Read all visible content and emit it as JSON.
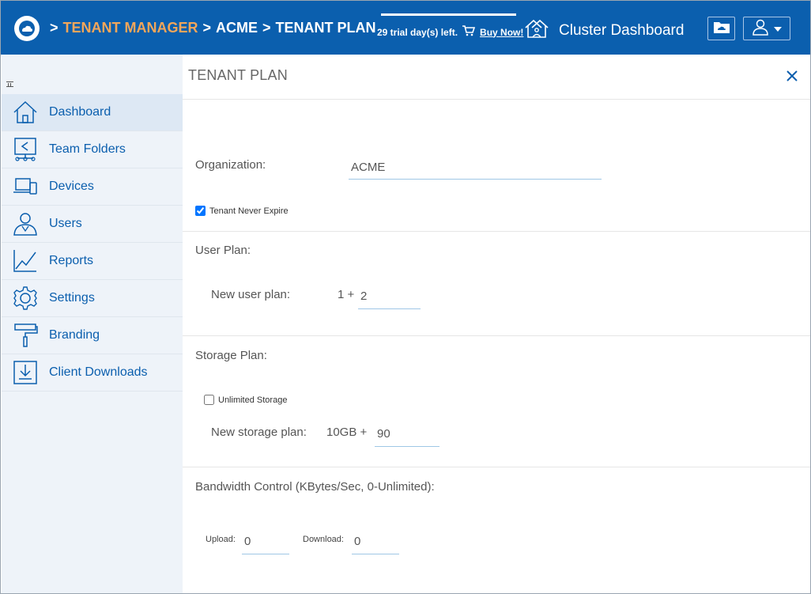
{
  "header": {
    "breadcrumb": {
      "sep": ">",
      "tenant_manager": "TENANT MANAGER",
      "acme": "ACME",
      "tenant_plan": "TENANT PLAN"
    },
    "trial_text": "29 trial day(s) left.",
    "buy_now": "Buy Now!",
    "cluster_dashboard": "Cluster Dashboard",
    "icons": {
      "logo": "cloud-logo-icon",
      "cart": "cart-icon",
      "cluster": "houses-icon",
      "folder": "cloud-folder-icon",
      "user": "user-icon",
      "caret": "caret-down-icon"
    }
  },
  "sidebar": {
    "items": [
      {
        "label": "Dashboard",
        "icon": "home-icon"
      },
      {
        "label": "Team Folders",
        "icon": "team-folder-icon"
      },
      {
        "label": "Devices",
        "icon": "devices-icon"
      },
      {
        "label": "Users",
        "icon": "users-icon"
      },
      {
        "label": "Reports",
        "icon": "reports-icon"
      },
      {
        "label": "Settings",
        "icon": "gear-icon"
      },
      {
        "label": "Branding",
        "icon": "paint-roller-icon"
      },
      {
        "label": "Client Downloads",
        "icon": "download-icon"
      }
    ]
  },
  "panel": {
    "title": "TENANT PLAN",
    "organization_label": "Organization:",
    "organization_value": "ACME",
    "never_expire_label": "Tenant Never Expire",
    "never_expire_checked": true,
    "user_plan_heading": "User Plan:",
    "new_user_plan_label": "New user plan:",
    "user_plan_base": "1 +",
    "user_plan_value": "2",
    "storage_plan_heading": "Storage Plan:",
    "unlimited_storage_label": "Unlimited Storage",
    "unlimited_storage_checked": false,
    "new_storage_plan_label": "New storage plan:",
    "storage_plan_base": "10GB +",
    "storage_plan_value": "90",
    "bandwidth_heading": "Bandwidth Control (KBytes/Sec, 0-Unlimited):",
    "upload_label": "Upload:",
    "upload_value": "0",
    "download_label": "Download:",
    "download_value": "0"
  },
  "colors": {
    "brand": "#0b5fae",
    "accent_orange": "#f2a65a",
    "sidebar_bg": "#eef3f9"
  }
}
